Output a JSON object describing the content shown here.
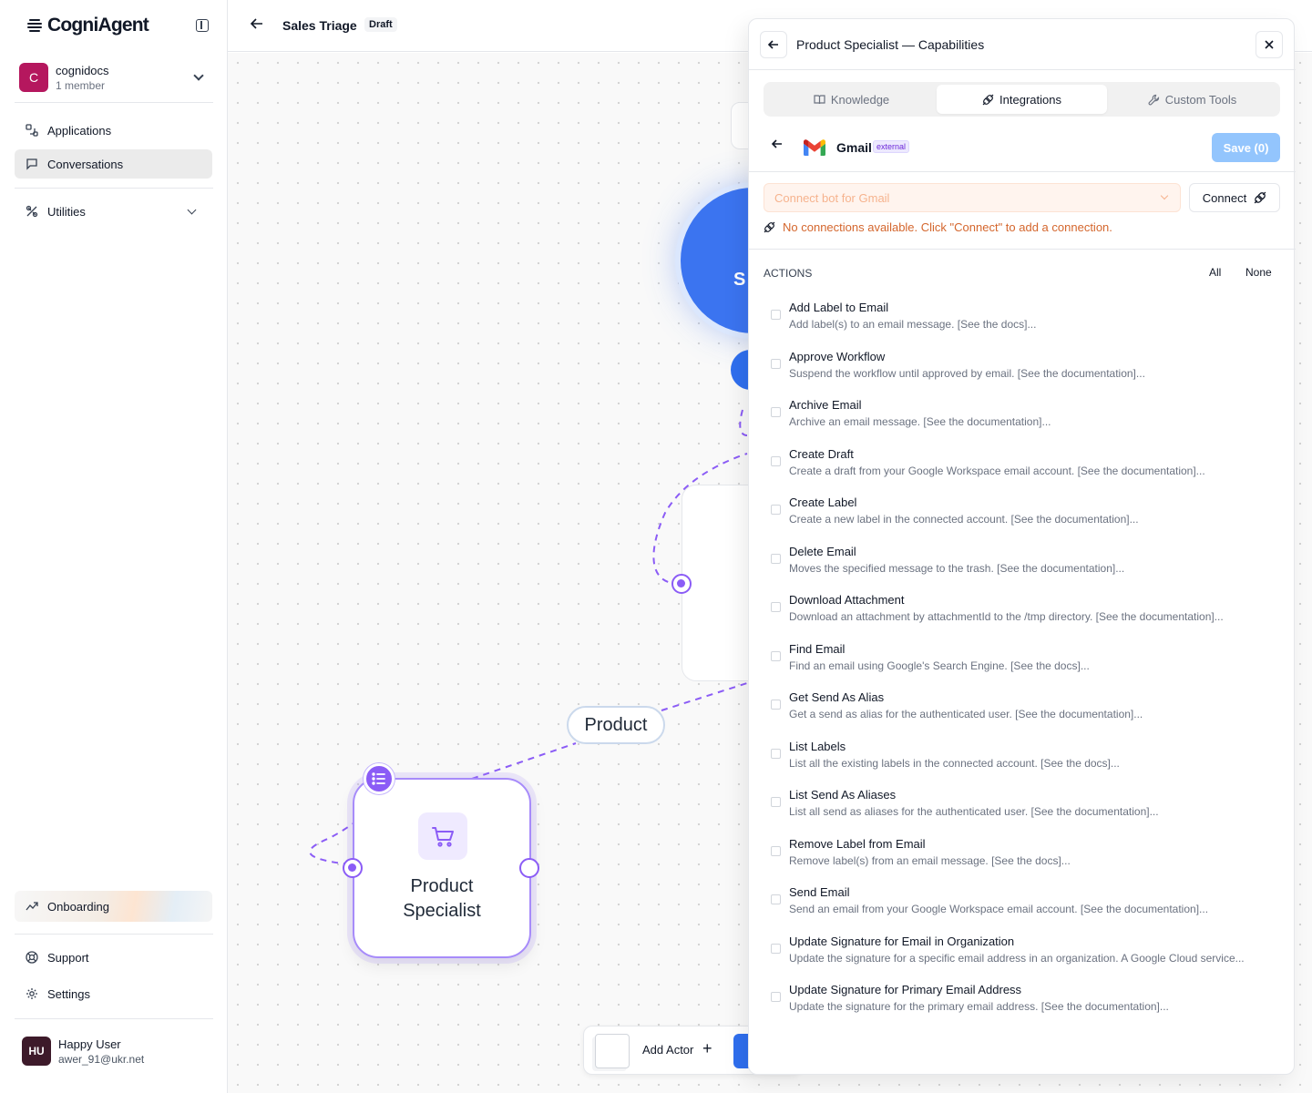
{
  "app": {
    "name": "CogniAgent"
  },
  "workspace": {
    "initial": "C",
    "name": "cognidocs",
    "members": "1 member"
  },
  "nav": {
    "applications": "Applications",
    "conversations": "Conversations",
    "utilities": "Utilities",
    "onboarding": "Onboarding",
    "support": "Support",
    "settings": "Settings"
  },
  "user": {
    "initials": "HU",
    "name": "Happy User",
    "email": "awer_91@ukr.net"
  },
  "flow": {
    "title": "Sales Triage",
    "status": "Draft"
  },
  "canvas": {
    "edge_label": "Product",
    "node_label_line1": "Product",
    "node_label_line2": "Specialist",
    "blue_node_partial": "S",
    "add_actor": "Add Actor"
  },
  "panel": {
    "title": "Product Specialist — Capabilities",
    "tabs": [
      {
        "label": "Knowledge",
        "icon": "book-icon"
      },
      {
        "label": "Integrations",
        "icon": "plug-icon"
      },
      {
        "label": "Custom Tools",
        "icon": "wrench-icon"
      }
    ],
    "integration": {
      "name": "Gmail",
      "tag": "external",
      "save_label": "Save (0)"
    },
    "connection": {
      "placeholder": "Connect bot for Gmail",
      "connect_label": "Connect",
      "warning": "No connections available. Click \"Connect\" to add a connection."
    },
    "actions_heading": "ACTIONS",
    "select_all": "All",
    "select_none": "None",
    "actions": [
      {
        "title": "Add Label to Email",
        "desc": "Add label(s) to an email message. [See the docs]..."
      },
      {
        "title": "Approve Workflow",
        "desc": "Suspend the workflow until approved by email. [See the documentation]..."
      },
      {
        "title": "Archive Email",
        "desc": "Archive an email message. [See the documentation]..."
      },
      {
        "title": "Create Draft",
        "desc": "Create a draft from your Google Workspace email account. [See the documentation]..."
      },
      {
        "title": "Create Label",
        "desc": "Create a new label in the connected account. [See the documentation]..."
      },
      {
        "title": "Delete Email",
        "desc": "Moves the specified message to the trash. [See the documentation]..."
      },
      {
        "title": "Download Attachment",
        "desc": "Download an attachment by attachmentId to the /tmp directory. [See the documentation]..."
      },
      {
        "title": "Find Email",
        "desc": "Find an email using Google's Search Engine. [See the docs]..."
      },
      {
        "title": "Get Send As Alias",
        "desc": "Get a send as alias for the authenticated user. [See the documentation]..."
      },
      {
        "title": "List Labels",
        "desc": "List all the existing labels in the connected account. [See the docs]..."
      },
      {
        "title": "List Send As Aliases",
        "desc": "List all send as aliases for the authenticated user. [See the documentation]..."
      },
      {
        "title": "Remove Label from Email",
        "desc": "Remove label(s) from an email message. [See the docs]..."
      },
      {
        "title": "Send Email",
        "desc": "Send an email from your Google Workspace email account. [See the documentation]..."
      },
      {
        "title": "Update Signature for Email in Organization",
        "desc": "Update the signature for a specific email address in an organization. A Google Cloud service..."
      },
      {
        "title": "Update Signature for Primary Email Address",
        "desc": "Update the signature for the primary email address. [See the documentation]..."
      }
    ]
  },
  "colors": {
    "accent_purple": "#8b5cf6",
    "accent_blue": "#3b74f0",
    "warning_orange": "#d4662d"
  }
}
